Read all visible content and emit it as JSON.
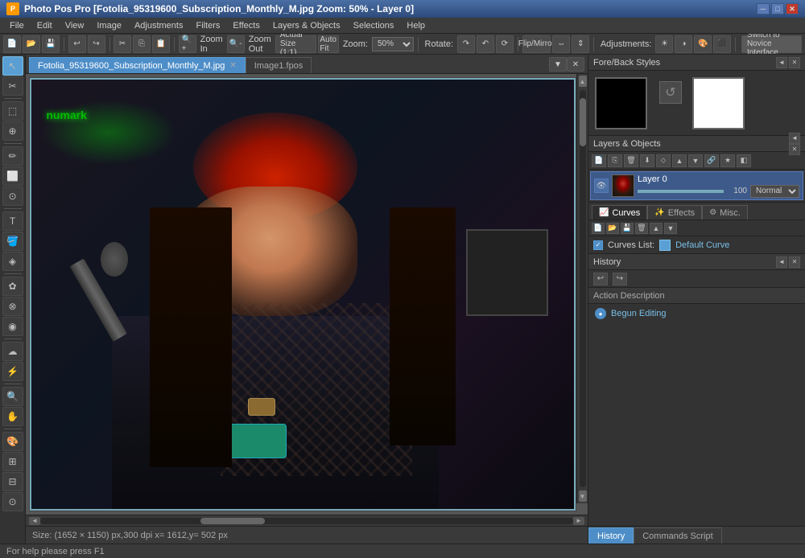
{
  "titleBar": {
    "title": "Photo Pos Pro [Fotolia_95319600_Subscription_Monthly_M.jpg Zoom: 50% - Layer 0]",
    "icon": "P",
    "minBtn": "─",
    "maxBtn": "□",
    "closeBtn": "✕"
  },
  "menuBar": {
    "items": [
      "File",
      "Edit",
      "View",
      "Image",
      "Adjustments",
      "Filters",
      "Effects",
      "Layers & Objects",
      "Selections",
      "Help"
    ]
  },
  "toolbar1": {
    "zoomIn": "Zoom In",
    "zoomOut": "Zoom Out",
    "actualSize": "Actual Size (1:1)",
    "autoFit": "Auto Fit",
    "zoomLabel": "Zoom:",
    "zoomValue": "50%",
    "rotate": "Rotate:",
    "flipMirror": "Flip/Mirror",
    "adjustments": "Adjustments:",
    "switchInterface": "Switch to Novice Interface"
  },
  "tabs": [
    {
      "label": "Fotolia_95319600_Subscription_Monthly_M.jpg",
      "active": true
    },
    {
      "label": "Image1.fpos",
      "active": false
    }
  ],
  "leftTools": {
    "tools": [
      "↖",
      "✂",
      "⬚",
      "⊕",
      "✏",
      "⬜",
      "○",
      "△",
      "T",
      "🪣",
      "✿",
      "⊗",
      "◉",
      "☁",
      "⚡",
      "🔍",
      "✋",
      "🎨",
      "⊞",
      "⊟",
      "⊙",
      "◈"
    ]
  },
  "canvas": {
    "scrollbarLabel": "",
    "statusText": "Size: (1652 × 1150) px,300 dpi   x= 1612,y= 502 px"
  },
  "rightPanel": {
    "foreBackStyles": {
      "title": "Fore/Back Styles",
      "swatchBlack": "Black",
      "swatchWhite": "White",
      "rotateIcon": "↺"
    },
    "layersObjects": {
      "title": "Layers & Objects",
      "layerName": "Layer 0",
      "opacity": "100",
      "blendMode": "Normal"
    },
    "adjustmentTabs": [
      {
        "label": "Curves",
        "icon": "📈",
        "active": true
      },
      {
        "label": "Effects",
        "icon": "✨",
        "active": false
      },
      {
        "label": "Misc.",
        "icon": "⚙",
        "active": false
      }
    ],
    "curvesList": {
      "label": "Curves List:",
      "curveName": "Default Curve",
      "checked": true
    },
    "historyPanel": {
      "title": "History",
      "actionDesc": "Action Description",
      "items": [
        {
          "text": "Begun Editing"
        }
      ],
      "bottomTabs": [
        {
          "label": "History",
          "active": true
        },
        {
          "label": "Commands Script",
          "active": false
        }
      ]
    }
  },
  "statusBar": {
    "text": "For help please press F1"
  }
}
